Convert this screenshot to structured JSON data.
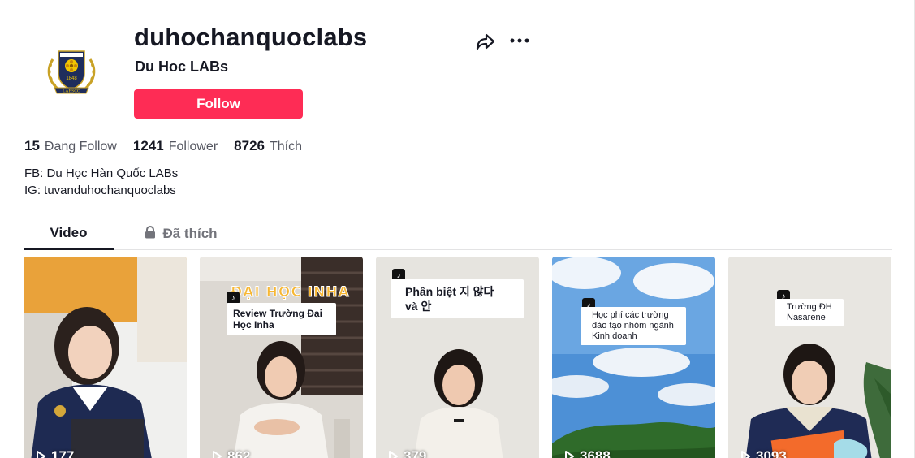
{
  "profile": {
    "username": "duhochanquoclabs",
    "nickname": "Du Hoc LABs",
    "follow_label": "Follow",
    "logo_year": "1848",
    "logo_text": "LABSCO"
  },
  "stats": {
    "following_count": "15",
    "following_label": "Đang Follow",
    "followers_count": "1241",
    "followers_label": "Follower",
    "likes_count": "8726",
    "likes_label": "Thích"
  },
  "bio": {
    "line1": "FB: Du Học Hàn Quốc LABs",
    "line2": "IG: tuvanduhochanquoclabs"
  },
  "tabs": {
    "video_label": "Video",
    "liked_label": "Đã thích"
  },
  "videos": [
    {
      "views": "177",
      "caption": "",
      "overlay_title": ""
    },
    {
      "views": "862",
      "caption": "Review Trường Đại Học Inha",
      "overlay_title": "ĐẠI HỌC INHA"
    },
    {
      "views": "379",
      "caption": "Phân biệt 지 않다 và 안",
      "overlay_title": ""
    },
    {
      "views": "3688",
      "caption": "Học phí các trường đào tạo nhóm ngành Kinh doanh",
      "overlay_title": ""
    },
    {
      "views": "3093",
      "caption": "Trường ĐH Nasarene",
      "overlay_title": ""
    }
  ],
  "colors": {
    "accent": "#fe2c55",
    "text": "#161823",
    "muted": "#73747b"
  },
  "icons": [
    "share-icon",
    "more-icon",
    "lock-icon",
    "play-icon",
    "tiktok-badge-icon"
  ]
}
